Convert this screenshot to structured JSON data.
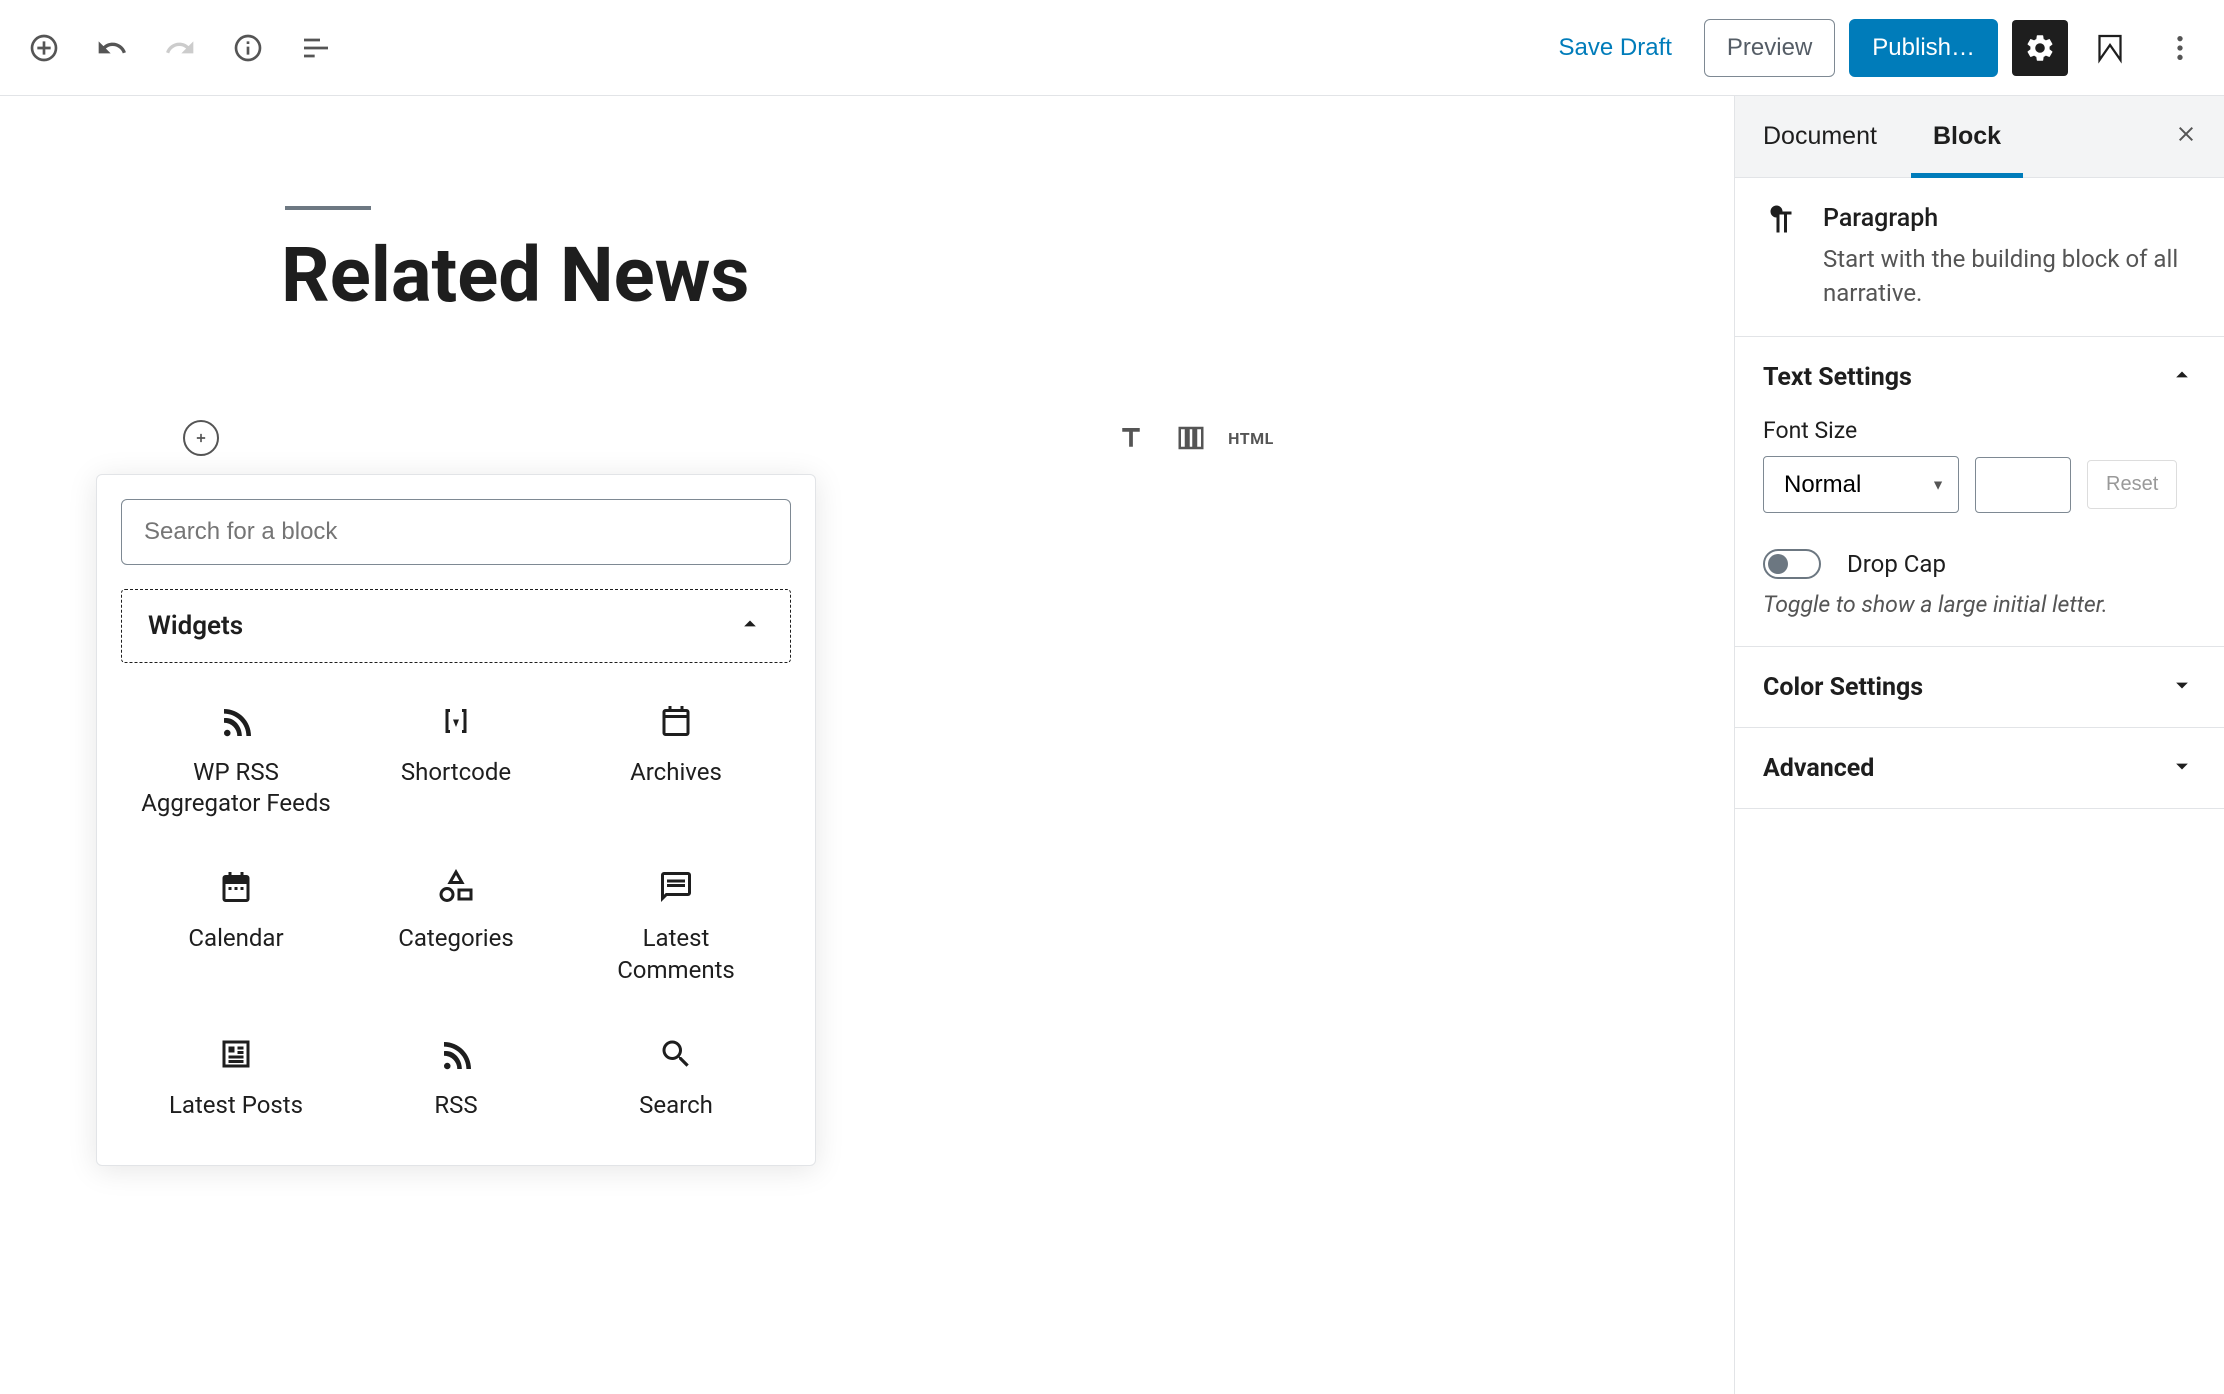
{
  "toolbar": {
    "save_draft": "Save Draft",
    "preview": "Preview",
    "publish": "Publish…"
  },
  "post": {
    "title": "Related News"
  },
  "block_tools": {
    "html": "HTML"
  },
  "inserter": {
    "search_placeholder": "Search for a block",
    "category": "Widgets",
    "blocks": [
      {
        "label": "WP RSS Aggregator Feeds",
        "icon": "rss"
      },
      {
        "label": "Shortcode",
        "icon": "shortcode"
      },
      {
        "label": "Archives",
        "icon": "archives"
      },
      {
        "label": "Calendar",
        "icon": "calendar"
      },
      {
        "label": "Categories",
        "icon": "categories"
      },
      {
        "label": "Latest Comments",
        "icon": "comments"
      },
      {
        "label": "Latest Posts",
        "icon": "posts"
      },
      {
        "label": "RSS",
        "icon": "rss"
      },
      {
        "label": "Search",
        "icon": "search"
      }
    ]
  },
  "sidebar": {
    "tabs": {
      "document": "Document",
      "block": "Block"
    },
    "block_card": {
      "title": "Paragraph",
      "description": "Start with the building block of all narrative."
    },
    "panels": {
      "text_settings": {
        "title": "Text Settings",
        "font_size_label": "Font Size",
        "font_size_value": "Normal",
        "reset_label": "Reset",
        "drop_cap_label": "Drop Cap",
        "drop_cap_hint": "Toggle to show a large initial letter."
      },
      "color_settings": {
        "title": "Color Settings"
      },
      "advanced": {
        "title": "Advanced"
      }
    }
  }
}
